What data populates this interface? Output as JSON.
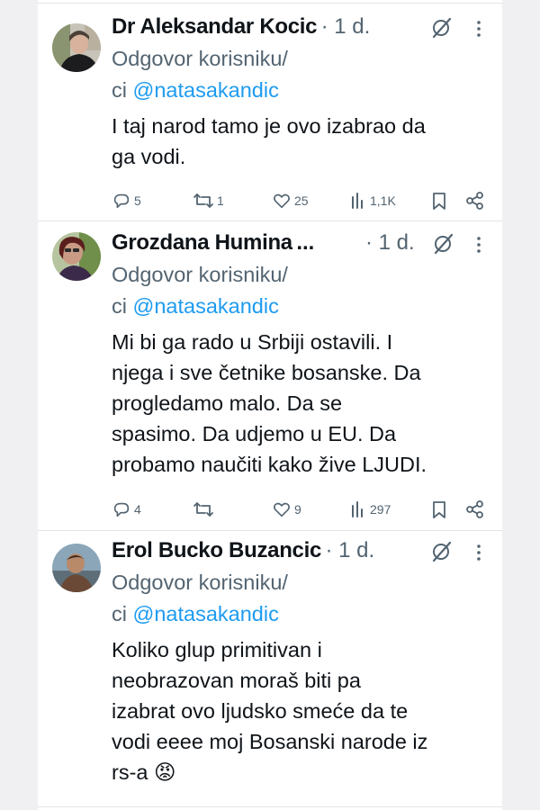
{
  "colors": {
    "text": "#0f1419",
    "secondary": "#536471",
    "mention": "#1d9bf0",
    "divider": "#e2e5e8"
  },
  "tweets": [
    {
      "author": "Dr Aleksandar Kocic",
      "time": "· 1 d.",
      "reply_label": "Odgovor korisniku/",
      "reply_prefix": "ci ",
      "mention": "@natasakandic",
      "body_lines": [
        "I taj narod tamo je ovo izabrao da",
        "ga vodi."
      ],
      "replies": "5",
      "reposts": "1",
      "likes": "25",
      "views": "1,1K",
      "icons": [
        "reply-icon",
        "repost-icon",
        "like-icon",
        "views-icon",
        "bookmark-icon",
        "share-icon",
        "grok-icon",
        "more-icon"
      ]
    },
    {
      "author": "Grozdana Humina",
      "author_suffix": "...",
      "time": "· 1 d.",
      "reply_label": "Odgovor korisniku/",
      "reply_prefix": "ci ",
      "mention": "@natasakandic",
      "body_lines": [
        "Mi bi ga rado u Srbiji ostavili. I",
        "njega i sve četnike bosanske. Da",
        "progledamo malo. Da se",
        "spasimo.  Da udjemo u EU. Da",
        "probamo naučiti kako žive LJUDI."
      ],
      "replies": "4",
      "reposts": "",
      "likes": "9",
      "views": "297"
    },
    {
      "author": "Erol Bucko Buzancic",
      "time": "· 1 d.",
      "reply_label": "Odgovor korisniku/",
      "reply_prefix": "ci ",
      "mention": "@natasakandic",
      "body_lines": [
        "Koliko glup primitivan i",
        "neobrazovan moraš biti pa",
        "izabrat ovo ljudsko smeće da te",
        "vodi eeee moj Bosanski narode iz",
        "rs-a 😡"
      ]
    }
  ]
}
